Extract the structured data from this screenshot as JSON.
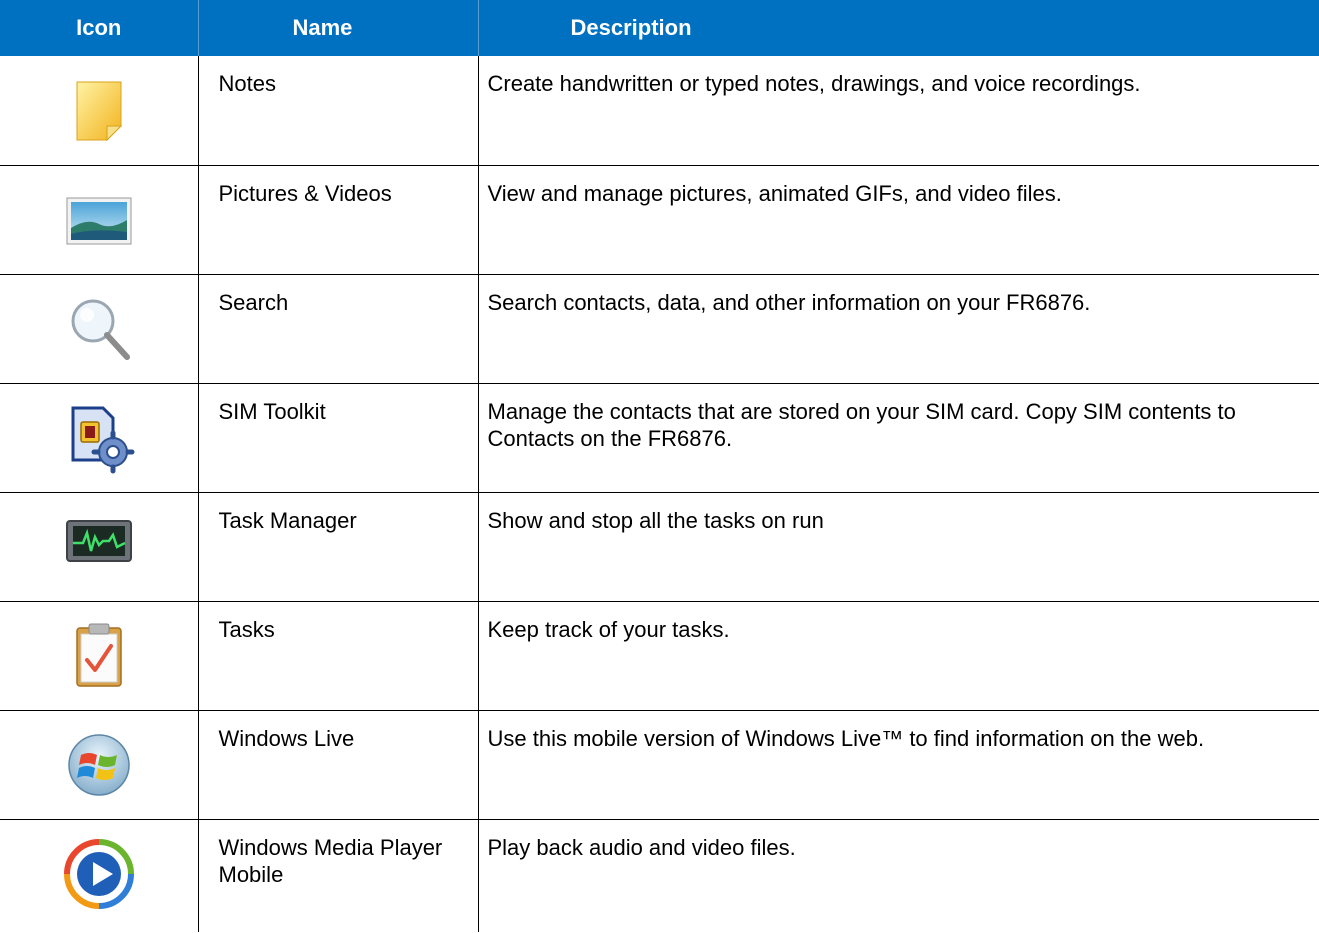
{
  "table": {
    "headers": {
      "icon": "Icon",
      "name": "Name",
      "description": "Description"
    },
    "rows": [
      {
        "icon": "notes-icon",
        "name": "Notes",
        "description": "Create handwritten or typed notes, drawings, and voice recordings."
      },
      {
        "icon": "pictures-videos-icon",
        "name": "Pictures & Videos",
        "description": "View and manage pictures, animated GIFs, and video files."
      },
      {
        "icon": "search-icon",
        "name": "Search",
        "description": "Search contacts, data, and other information on your FR6876."
      },
      {
        "icon": "sim-toolkit-icon",
        "name": "SIM Toolkit",
        "description": "Manage the contacts that are stored on your SIM card. Copy SIM contents to Contacts on the FR6876."
      },
      {
        "icon": "task-manager-icon",
        "name": "Task Manager",
        "description": "Show and stop all the tasks on run"
      },
      {
        "icon": "tasks-icon",
        "name": "Tasks",
        "description": "Keep track of your tasks."
      },
      {
        "icon": "windows-live-icon",
        "name": "Windows Live",
        "description": "Use this mobile version of Windows Live™ to find information on the web."
      },
      {
        "icon": "windows-media-player-icon",
        "name": "Windows Media Player Mobile",
        "description": "Play back audio and video files."
      }
    ]
  },
  "colors": {
    "header_bg": "#0070c0",
    "header_text": "#ffffff",
    "border": "#000000"
  }
}
